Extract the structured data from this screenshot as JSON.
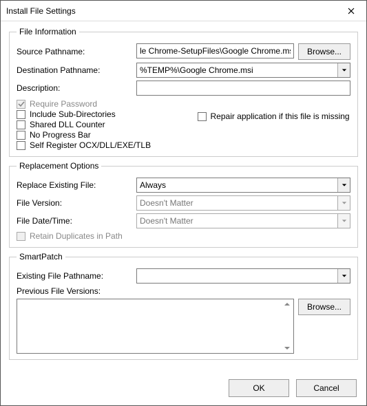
{
  "window": {
    "title": "Install File Settings"
  },
  "fileInfo": {
    "legend": "File Information",
    "sourceLabel": "Source Pathname:",
    "sourceValue": "le Chrome-SetupFiles\\Google Chrome.msi",
    "browse1": "Browse...",
    "destLabel": "Destination Pathname:",
    "destValue": "%TEMP%\\Google Chrome.msi",
    "descLabel": "Description:",
    "descValue": "",
    "requirePassword": "Require Password",
    "includeSub": "Include Sub-Directories",
    "sharedDll": "Shared DLL Counter",
    "noProgress": "No Progress Bar",
    "selfRegister": "Self Register OCX/DLL/EXE/TLB",
    "repairApp": "Repair application if this file is missing"
  },
  "replacement": {
    "legend": "Replacement Options",
    "replaceLabel": "Replace Existing File:",
    "replaceValue": "Always",
    "versionLabel": "File Version:",
    "versionValue": "Doesn't Matter",
    "dateLabel": "File Date/Time:",
    "dateValue": "Doesn't Matter",
    "retain": "Retain Duplicates in Path"
  },
  "smartPatch": {
    "legend": "SmartPatch",
    "existingLabel": "Existing File Pathname:",
    "existingValue": "",
    "prevLabel": "Previous File Versions:",
    "browse2": "Browse..."
  },
  "footer": {
    "ok": "OK",
    "cancel": "Cancel"
  }
}
